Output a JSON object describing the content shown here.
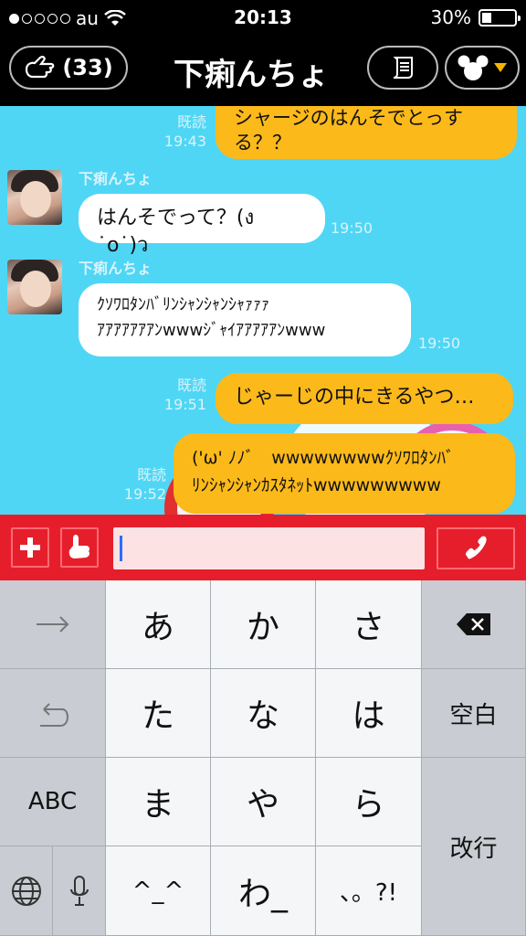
{
  "status": {
    "carrier": "au",
    "time": "20:13",
    "battery": "30%",
    "battery_level": 0.3,
    "signal_bars": 1
  },
  "header": {
    "friends_count": "(33)",
    "title": "下痢んちょ"
  },
  "messages": [
    {
      "side": "me",
      "text": "シャージのはんそでとっする？？",
      "read": "既読",
      "time": "19:43"
    },
    {
      "side": "them",
      "name": "下痢んちょ",
      "text": "はんそでって？(ง ˙o˙)ว",
      "time": "19:50"
    },
    {
      "side": "them",
      "name": "下痢んちょ",
      "text_line1": "ｸｿﾜﾛﾀﾝﾊﾞﾘﾝｼｬﾝｼｬﾝｼｬｧｧｧ",
      "text_line2": "ｱｱｱｱｱｱｱﾝwwwｼﾞｬｲｱｱｱｱｱﾝwww",
      "time": "19:50"
    },
    {
      "side": "me",
      "text": "じゃーじの中にきるやつ…",
      "read": "既読",
      "time": "19:51"
    },
    {
      "side": "me",
      "text_line1": "('ω' ﾉﾉﾞ　wwwwwwwwｸｿﾜﾛﾀﾝﾊﾞ",
      "text_line2": "ﾘﾝｼｬﾝｼｬﾝｶｽﾀﾈｯﾄwwwwwwwww",
      "read": "既読",
      "time": "19:52"
    }
  ],
  "input": {
    "value": "",
    "placeholder": ""
  },
  "keyboard": {
    "row1": [
      "→",
      "あ",
      "か",
      "さ",
      "⌫"
    ],
    "row2": [
      "↺",
      "た",
      "な",
      "は",
      "空白"
    ],
    "row3": [
      "ABC",
      "ま",
      "や",
      "ら",
      "改行"
    ],
    "row4": [
      "globe",
      "mic",
      "^_^",
      "わ_",
      "、。?!"
    ]
  },
  "colors": {
    "accent_red": "#e61e2b",
    "bubble_yellow": "#fbb91a",
    "chat_bg": "#4fd6f5"
  }
}
